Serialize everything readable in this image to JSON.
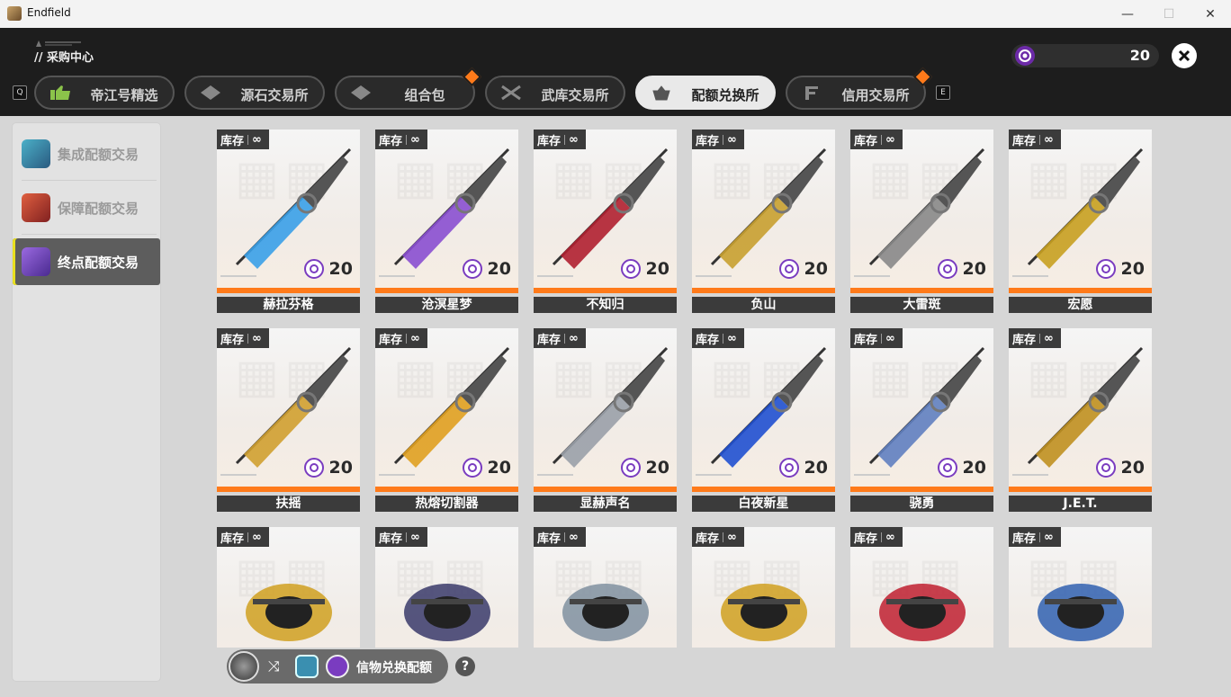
{
  "window": {
    "title": "Endfield",
    "min": "—",
    "max": "☐",
    "close": "✕"
  },
  "header": {
    "section_title": "// 采购中心",
    "balance": "20",
    "key_left": "Q",
    "key_right": "E"
  },
  "tabs": [
    {
      "label": "帝江号精选",
      "icon": "thumbs-up-icon",
      "active": false,
      "badge": false
    },
    {
      "label": "源石交易所",
      "icon": "originium-icon",
      "active": false,
      "badge": false
    },
    {
      "label": "组合包",
      "icon": "bundle-icon",
      "active": false,
      "badge": true
    },
    {
      "label": "武库交易所",
      "icon": "crossed-swords-icon",
      "active": false,
      "badge": false
    },
    {
      "label": "配额兑换所",
      "icon": "basket-icon",
      "active": true,
      "badge": false
    },
    {
      "label": "信用交易所",
      "icon": "credit-icon",
      "active": false,
      "badge": true
    }
  ],
  "sidebar": {
    "items": [
      {
        "label": "集成配额交易",
        "active": false
      },
      {
        "label": "保障配额交易",
        "active": false
      },
      {
        "label": "终点配额交易",
        "active": true
      }
    ]
  },
  "cards": [
    {
      "stock": "库存",
      "inf": "∞",
      "price": "20",
      "name": "赫拉芬格",
      "color": "#3aa0e8"
    },
    {
      "stock": "库存",
      "inf": "∞",
      "price": "20",
      "name": "沧溟星梦",
      "color": "#8a4fd0"
    },
    {
      "stock": "库存",
      "inf": "∞",
      "price": "20",
      "name": "不知归",
      "color": "#b02030"
    },
    {
      "stock": "库存",
      "inf": "∞",
      "price": "20",
      "name": "负山",
      "color": "#c8a030"
    },
    {
      "stock": "库存",
      "inf": "∞",
      "price": "20",
      "name": "大雷斑",
      "color": "#888888"
    },
    {
      "stock": "库存",
      "inf": "∞",
      "price": "20",
      "name": "宏愿",
      "color": "#c8a020"
    },
    {
      "stock": "库存",
      "inf": "∞",
      "price": "20",
      "name": "扶摇",
      "color": "#d0a030"
    },
    {
      "stock": "库存",
      "inf": "∞",
      "price": "20",
      "name": "热熔切割器",
      "color": "#e0a020"
    },
    {
      "stock": "库存",
      "inf": "∞",
      "price": "20",
      "name": "显赫声名",
      "color": "#9aa0a8"
    },
    {
      "stock": "库存",
      "inf": "∞",
      "price": "20",
      "name": "白夜新星",
      "color": "#2050d0"
    },
    {
      "stock": "库存",
      "inf": "∞",
      "price": "20",
      "name": "骁勇",
      "color": "#6080c0"
    },
    {
      "stock": "库存",
      "inf": "∞",
      "price": "20",
      "name": "J.E.T.",
      "color": "#c09020"
    },
    {
      "stock": "库存",
      "inf": "∞",
      "price": "",
      "name": "",
      "color": "#d0a020"
    },
    {
      "stock": "库存",
      "inf": "∞",
      "price": "",
      "name": "",
      "color": "#3a3a6a"
    },
    {
      "stock": "库存",
      "inf": "∞",
      "price": "",
      "name": "",
      "color": "#8090a0"
    },
    {
      "stock": "库存",
      "inf": "∞",
      "price": "",
      "name": "",
      "color": "#d0a020"
    },
    {
      "stock": "库存",
      "inf": "∞",
      "price": "",
      "name": "",
      "color": "#c02030"
    },
    {
      "stock": "库存",
      "inf": "∞",
      "price": "",
      "name": "",
      "color": "#3060b0"
    }
  ],
  "exchange": {
    "label": "信物兑换配额",
    "shuffle": "⤨",
    "help": "?"
  },
  "colors": {
    "accent": "#ff7a1a",
    "quota_purple": "#7a3cc0",
    "active_bar": "#e8e020"
  }
}
